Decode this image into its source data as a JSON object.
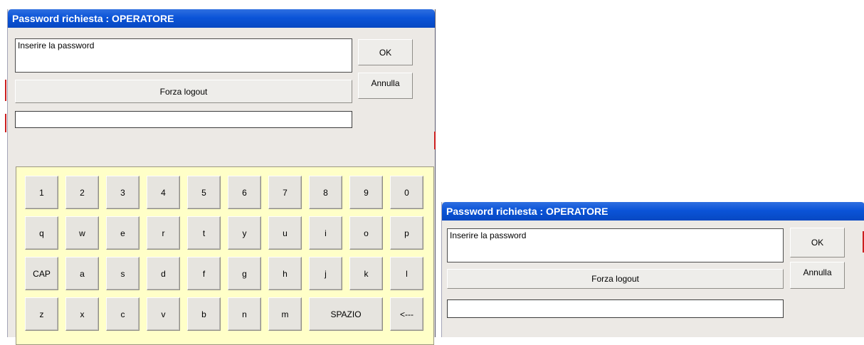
{
  "dialog_large": {
    "title": "Password richiesta : OPERATORE",
    "message": "Inserire la password",
    "ok_label": "OK",
    "cancel_label": "Annulla",
    "force_logout_label": "Forza logout",
    "password_value": ""
  },
  "keyboard": {
    "rows": [
      [
        "1",
        "2",
        "3",
        "4",
        "5",
        "6",
        "7",
        "8",
        "9",
        "0"
      ],
      [
        "q",
        "w",
        "e",
        "r",
        "t",
        "y",
        "u",
        "i",
        "o",
        "p"
      ],
      [
        "CAP",
        "a",
        "s",
        "d",
        "f",
        "g",
        "h",
        "j",
        "k",
        "l"
      ],
      [
        "z",
        "x",
        "c",
        "v",
        "b",
        "n",
        "m",
        "SPAZIO",
        "<---"
      ]
    ]
  },
  "dialog_small": {
    "title": "Password richiesta : OPERATORE",
    "message": "Inserire la password",
    "ok_label": "OK",
    "cancel_label": "Annulla",
    "force_logout_label": "Forza logout",
    "password_value": ""
  },
  "colors": {
    "titlebar": "#0b54d8",
    "dialog_bg": "#ece9e5",
    "keyboard_bg": "#ffffc8"
  }
}
